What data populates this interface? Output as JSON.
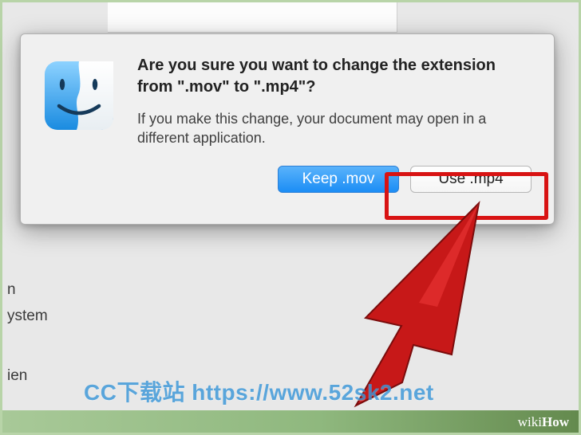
{
  "sidebar": {
    "item1": "n",
    "item2": "ystem",
    "item3": "ien"
  },
  "dialog": {
    "title": "Are you sure you want to change the extension from \".mov\" to \".mp4\"?",
    "message": "If you make this change, your document may open in a different application.",
    "keep_label": "Keep .mov",
    "use_label": "Use .mp4"
  },
  "watermark": "CC下载站  https://www.52sk2.net",
  "brand": {
    "prefix": "wiki",
    "suffix": "How"
  }
}
